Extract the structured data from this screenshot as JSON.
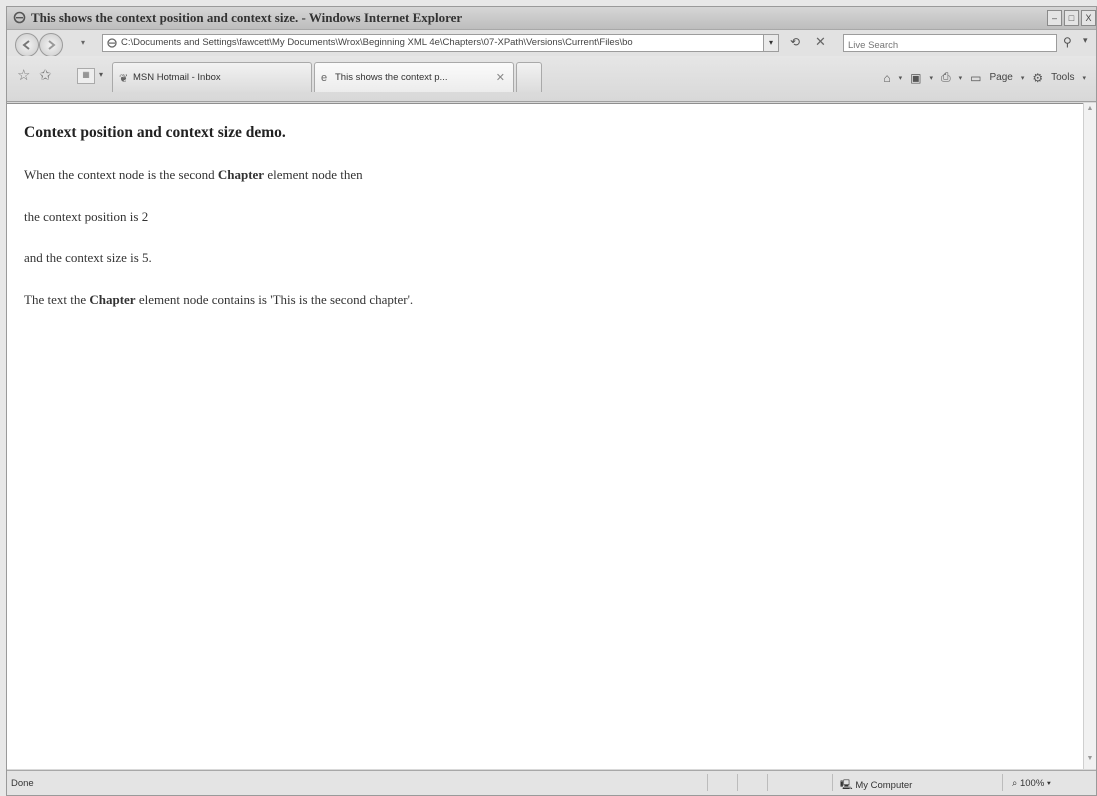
{
  "window": {
    "title": "This shows the context position and context size. - Windows Internet Explorer",
    "controls": [
      "–",
      "□",
      "X"
    ]
  },
  "address_bar": {
    "url": "C:\\Documents and Settings\\fawcett\\My Documents\\Wrox\\Beginning XML 4e\\Chapters\\07-XPath\\Versions\\Current\\Files\\bo",
    "search_placeholder": "Live Search",
    "recent_pages": "▾",
    "dropdown": "▾"
  },
  "tabs": [
    {
      "label": "MSN Hotmail - Inbox",
      "icon": "msn-butterfly-icon",
      "active": false
    },
    {
      "label": "This shows the context p...",
      "icon": "ie-page-icon",
      "active": true,
      "close": "✕"
    }
  ],
  "command_bar": {
    "page_label": "Page",
    "tools_label": "Tools",
    "dropdown": "▾"
  },
  "content": {
    "heading": "Context position and context size demo.",
    "line1_pre": "When the context node is the second ",
    "line1_bold": "Chapter",
    "line1_post": " element node then",
    "line2": "the context position is 2",
    "line3": "and the context size is 5.",
    "line4_pre": "The text the ",
    "line4_bold": "Chapter",
    "line4_post": " element node contains is 'This is the second chapter'."
  },
  "status_bar": {
    "status": "Done",
    "zone": "My Computer",
    "zoom": "100%",
    "zoom_dropdown": "▾"
  },
  "colors": {
    "chrome": "#d9d9d9",
    "content_bg": "#ffffff",
    "text": "#333333"
  }
}
